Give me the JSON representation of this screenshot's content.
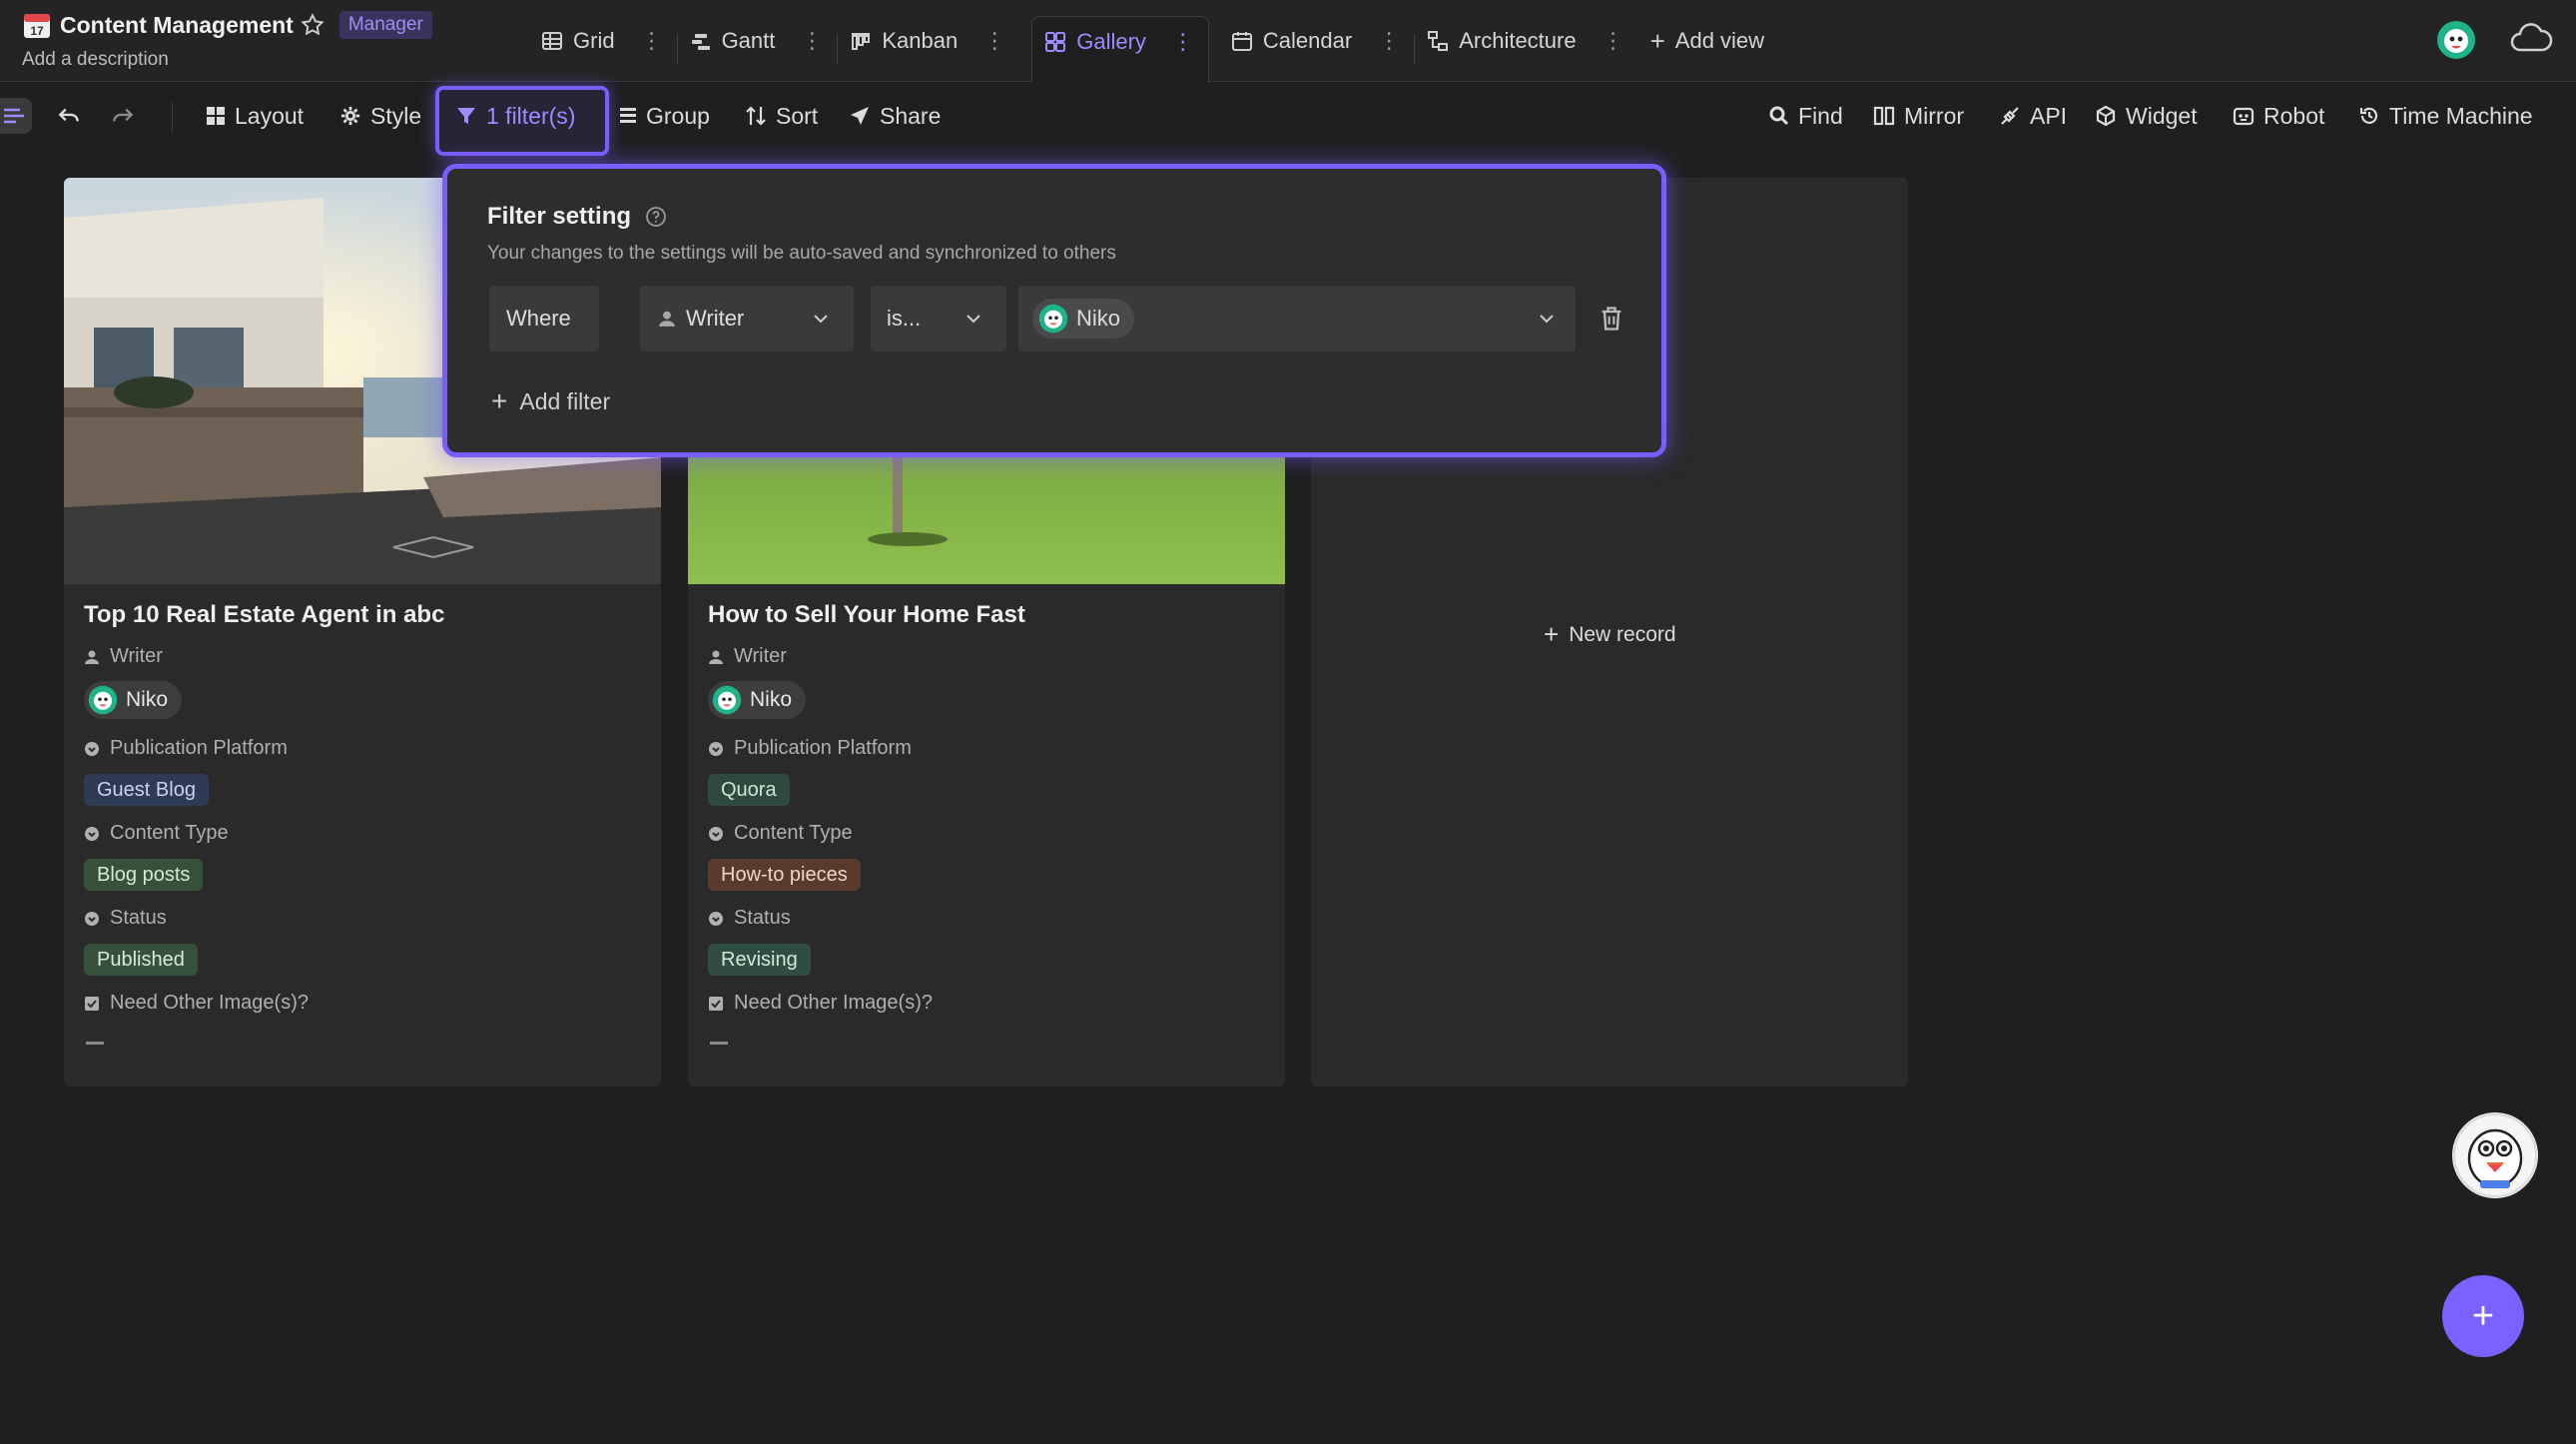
{
  "header": {
    "title": "Content Management",
    "role": "Manager",
    "description": "Add a description"
  },
  "views": [
    {
      "label": "Grid",
      "icon": "grid-icon"
    },
    {
      "label": "Gantt",
      "icon": "gantt-icon"
    },
    {
      "label": "Kanban",
      "icon": "kanban-icon"
    },
    {
      "label": "Gallery",
      "icon": "gallery-icon",
      "active": true
    },
    {
      "label": "Calendar",
      "icon": "calendar-icon"
    },
    {
      "label": "Architecture",
      "icon": "architecture-icon"
    }
  ],
  "add_view_label": "Add view",
  "toolbar": {
    "layout": "Layout",
    "style": "Style",
    "filter": "1 filter(s)",
    "group": "Group",
    "sort": "Sort",
    "share": "Share",
    "find": "Find",
    "mirror": "Mirror",
    "api": "API",
    "widget": "Widget",
    "robot": "Robot",
    "time_machine": "Time Machine"
  },
  "cards": [
    {
      "title": "Top 10 Real Estate Agent in abc",
      "writer_label": "Writer",
      "writer": "Niko",
      "platform_label": "Publication Platform",
      "platform": "Guest Blog",
      "content_type_label": "Content Type",
      "content_type": "Blog posts",
      "status_label": "Status",
      "status": "Published",
      "need_images_label": "Need Other Image(s)?"
    },
    {
      "title": "How to Sell Your Home Fast",
      "writer_label": "Writer",
      "writer": "Niko",
      "platform_label": "Publication Platform",
      "platform": "Quora",
      "content_type_label": "Content Type",
      "content_type": "How-to pieces",
      "status_label": "Status",
      "status": "Revising",
      "need_images_label": "Need Other Image(s)?"
    }
  ],
  "new_record_label": "New record",
  "filter_popup": {
    "title": "Filter setting",
    "subtitle": "Your changes to the settings will be auto-saved and synchronized to others",
    "where": "Where",
    "field": "Writer",
    "operator": "is...",
    "value": "Niko",
    "add_filter": "Add filter"
  },
  "colors": {
    "accent": "#7b61ff",
    "tag_guest_blog": "#2f3a55",
    "tag_quora": "#2e4a3e",
    "tag_blog_posts": "#36503a",
    "tag_howto": "#5a3a2a",
    "tag_published": "#35503b",
    "tag_revising": "#2f4d40"
  }
}
